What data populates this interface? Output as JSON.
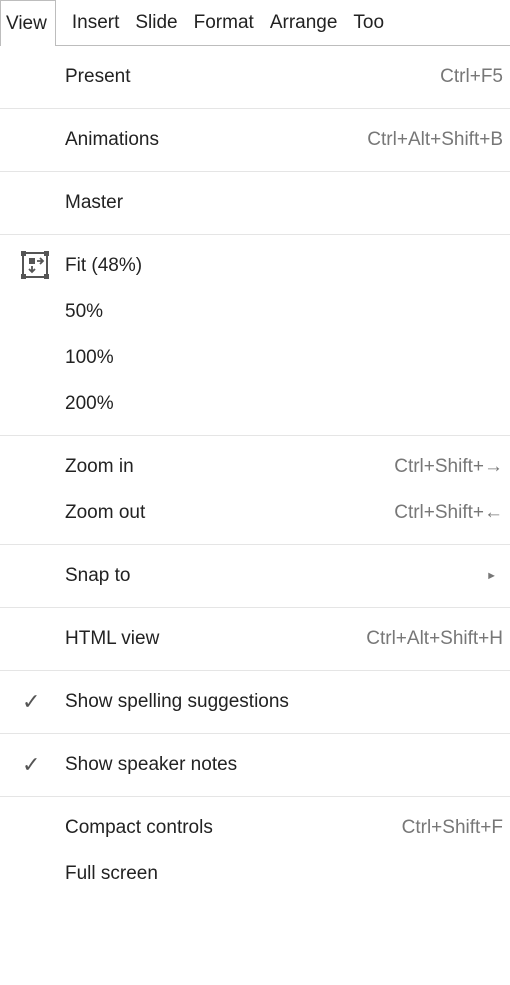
{
  "menubar": {
    "items": [
      {
        "label": "View",
        "active": true
      },
      {
        "label": "Insert"
      },
      {
        "label": "Slide"
      },
      {
        "label": "Format"
      },
      {
        "label": "Arrange"
      },
      {
        "label": "Too"
      }
    ]
  },
  "menu": {
    "present": {
      "label": "Present",
      "shortcut": "Ctrl+F5"
    },
    "animations": {
      "label": "Animations",
      "shortcut": "Ctrl+Alt+Shift+B"
    },
    "master": {
      "label": "Master"
    },
    "fit": {
      "label": "Fit (48%)",
      "icon": "fit-to-screen-icon"
    },
    "zoom50": {
      "label": "50%"
    },
    "zoom100": {
      "label": "100%"
    },
    "zoom200": {
      "label": "200%"
    },
    "zoom_in": {
      "label": "Zoom in",
      "shortcut": "Ctrl+Shift+→"
    },
    "zoom_out": {
      "label": "Zoom out",
      "shortcut": "Ctrl+Shift+←"
    },
    "snap_to": {
      "label": "Snap to",
      "submenu_arrow": "►"
    },
    "html_view": {
      "label": "HTML view",
      "shortcut": "Ctrl+Alt+Shift+H"
    },
    "spelling": {
      "label": "Show spelling suggestions",
      "checked": true,
      "check_glyph": "✓"
    },
    "speaker_notes": {
      "label": "Show speaker notes",
      "checked": true,
      "check_glyph": "✓"
    },
    "compact": {
      "label": "Compact controls",
      "shortcut": "Ctrl+Shift+F"
    },
    "full_screen": {
      "label": "Full screen"
    }
  }
}
